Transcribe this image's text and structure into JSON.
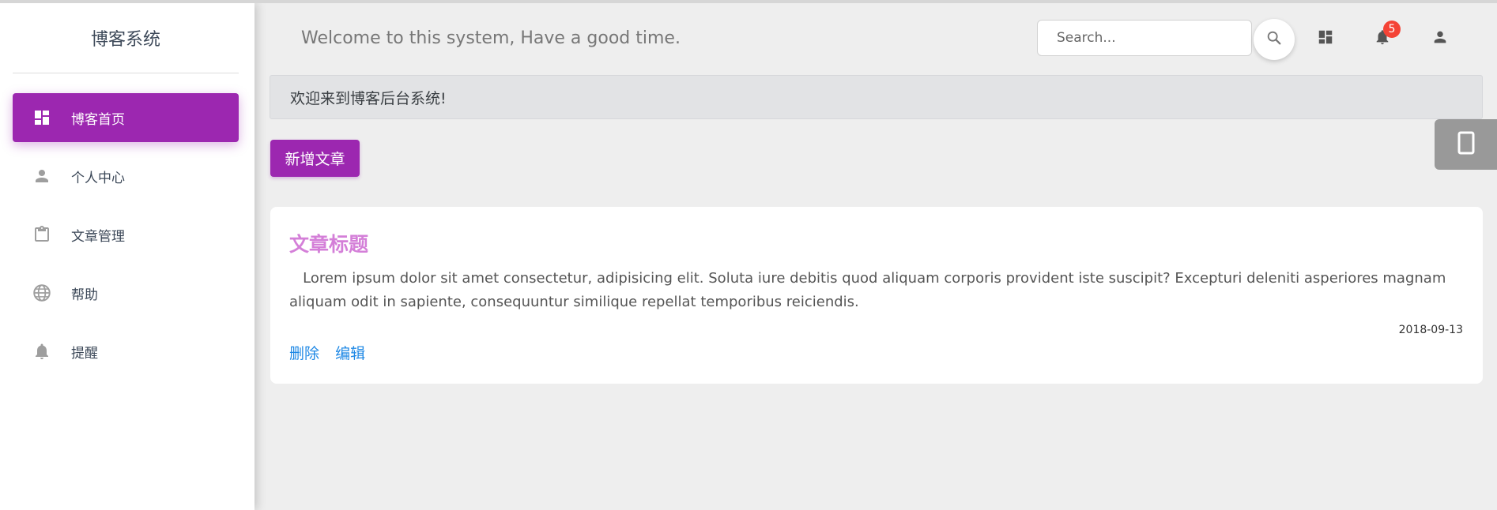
{
  "sidebar": {
    "brand": "博客系统",
    "items": [
      {
        "label": "博客首页",
        "icon": "dashboard-icon",
        "active": true
      },
      {
        "label": "个人中心",
        "icon": "person-icon",
        "active": false
      },
      {
        "label": "文章管理",
        "icon": "clipboard-icon",
        "active": false
      },
      {
        "label": "帮助",
        "icon": "globe-icon",
        "active": false
      },
      {
        "label": "提醒",
        "icon": "bell-icon",
        "active": false
      }
    ]
  },
  "header": {
    "welcome": "Welcome to this system, Have a good time.",
    "search_placeholder": "Search...",
    "notification_count": "5"
  },
  "alert": {
    "text": "欢迎来到博客后台系统!"
  },
  "toolbar": {
    "add_label": "新增文章"
  },
  "article": {
    "title": "文章标题",
    "body": "Lorem ipsum dolor sit amet consectetur, adipisicing elit. Soluta iure debitis quod aliquam corporis provident iste suscipit? Excepturi deleniti asperiores magnam aliquam odit in sapiente, consequuntur similique repellat temporibus reiciendis.",
    "date": "2018-09-13",
    "delete_label": "删除",
    "edit_label": "编辑"
  },
  "colors": {
    "accent": "#9c27b0",
    "title": "#d47fd8",
    "link": "#1e88e5",
    "badge": "#f44336"
  }
}
